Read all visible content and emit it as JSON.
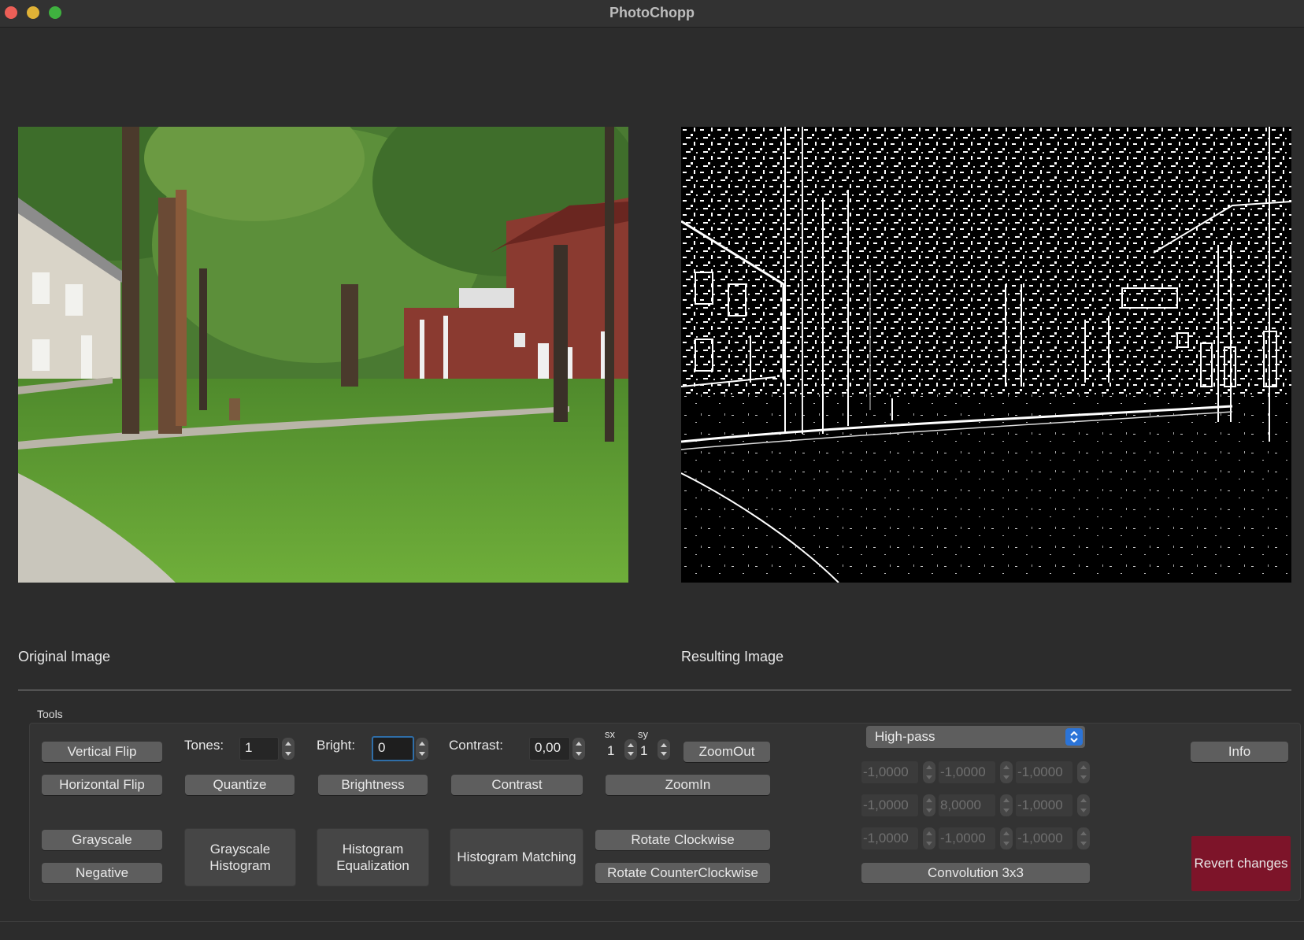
{
  "window": {
    "title": "PhotoChopp"
  },
  "images": {
    "original_caption": "Original Image",
    "result_caption": "Resulting Image"
  },
  "tools": {
    "section_label": "Tools",
    "vertical_flip": "Vertical Flip",
    "horizontal_flip": "Horizontal Flip",
    "grayscale": "Grayscale",
    "negative": "Negative",
    "tones_label": "Tones:",
    "tones_value": "1",
    "quantize": "Quantize",
    "grayscale_histogram": "Grayscale Histogram",
    "bright_label": "Bright:",
    "bright_value": "0",
    "brightness": "Brightness",
    "histogram_equalization": "Histogram Equalization",
    "contrast_label": "Contrast:",
    "contrast_value": "0,00",
    "contrast": "Contrast",
    "histogram_matching": "Histogram Matching",
    "sx_label": "sx",
    "sy_label": "sy",
    "sx_value": "1",
    "sy_value": "1",
    "zoom_out": "ZoomOut",
    "zoom_in": "ZoomIn",
    "rotate_cw": "Rotate Clockwise",
    "rotate_ccw": "Rotate CounterClockwise",
    "filter_select": "High-pass",
    "kernel": [
      [
        "-1,0000",
        "-1,0000",
        "-1,0000"
      ],
      [
        "-1,0000",
        "8,0000",
        "-1,0000"
      ],
      [
        "-1,0000",
        "-1,0000",
        "-1,0000"
      ]
    ],
    "convolution": "Convolution 3x3",
    "info": "Info",
    "revert": "Revert changes"
  },
  "colors": {
    "background": "#2c2c2c",
    "button": "#5e5e5e",
    "revert": "#7d1429",
    "select_accent": "#2b74d8"
  }
}
